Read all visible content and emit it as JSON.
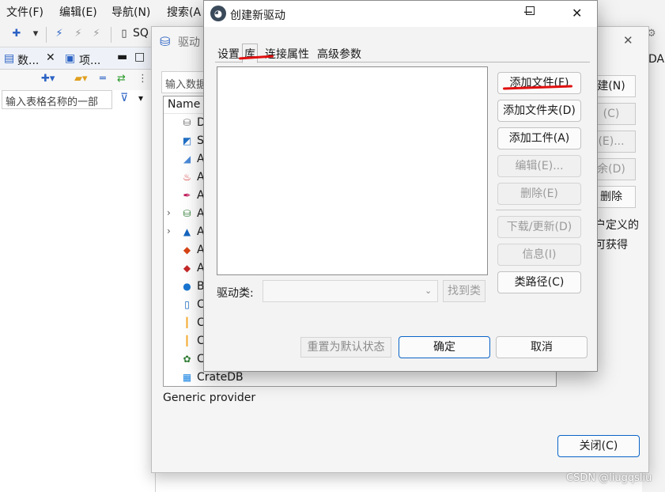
{
  "ide": {
    "menu": [
      "文件(F)",
      "编辑(E)",
      "导航(N)",
      "搜索(A"
    ],
    "toolbar_sql": "SQ",
    "left_tabs": [
      "数...",
      "项..."
    ],
    "filter_placeholder": "输入表格名称的一部",
    "right_fragment": "DA"
  },
  "driver_manager": {
    "title": "驱动",
    "search_placeholder": "输入数据",
    "column_header": "Name",
    "rows": [
      {
        "label": "D",
        "icon": "database-icon",
        "color": "#6e6e6e"
      },
      {
        "label": "S",
        "icon": "sql-icon",
        "color": "#1f6fc5"
      },
      {
        "label": "A",
        "icon": "drop-icon",
        "color": "#4c8ad8"
      },
      {
        "label": "A",
        "icon": "flame-icon",
        "color": "#d62a2a"
      },
      {
        "label": "A",
        "icon": "feather-icon",
        "color": "#c2185b"
      },
      {
        "label": "A",
        "icon": "database-group-icon",
        "color": "#2e7d32"
      },
      {
        "label": "A",
        "icon": "azure-icon",
        "color": "#1565c0"
      },
      {
        "label": "A",
        "icon": "layers-icon",
        "color": "#d84315"
      },
      {
        "label": "A",
        "icon": "layers-icon",
        "color": "#c62828"
      },
      {
        "label": "B",
        "icon": "elephant-icon",
        "color": "#1976d2"
      },
      {
        "label": "C",
        "icon": "cylinder-icon",
        "color": "#1565c0"
      },
      {
        "label": "C",
        "icon": "bars-icon",
        "color": "#f9a825"
      },
      {
        "label": "C",
        "icon": "bars-icon",
        "color": "#f9a825"
      },
      {
        "label": "C",
        "icon": "bug-icon",
        "color": "#2e7d32"
      },
      {
        "label": "CrateDB",
        "icon": "grid-icon",
        "color": "#1e88e5"
      }
    ],
    "description": "Generic provider",
    "buttons": [
      "建(N)",
      "(C)",
      "(E)...",
      "余(D)",
      "删除"
    ],
    "side_text_1": "户定义的",
    "side_text_2": "可获得",
    "close_button": "关闭(C)"
  },
  "dialog": {
    "title": "创建新驱动",
    "tabs": [
      "设置",
      "库",
      "连接属性",
      "高级参数"
    ],
    "active_tab": 1,
    "buttons": {
      "add_file": "添加文件(F)",
      "add_folder": "添加文件夹(D)",
      "add_artifact": "添加工件(A)",
      "edit": "编辑(E)...",
      "delete": "删除(E)",
      "download_update": "下载/更新(D)",
      "info": "信息(I)",
      "classpath": "类路径(C)",
      "find_class": "找到类",
      "reset": "重置为默认状态",
      "ok": "确定",
      "cancel": "取消"
    },
    "driver_class_label": "驱动类:"
  },
  "watermark": "CSDN @liugqsliu",
  "colors": {
    "annotation_red": "#e01010",
    "primary_border": "#0a64c8"
  }
}
